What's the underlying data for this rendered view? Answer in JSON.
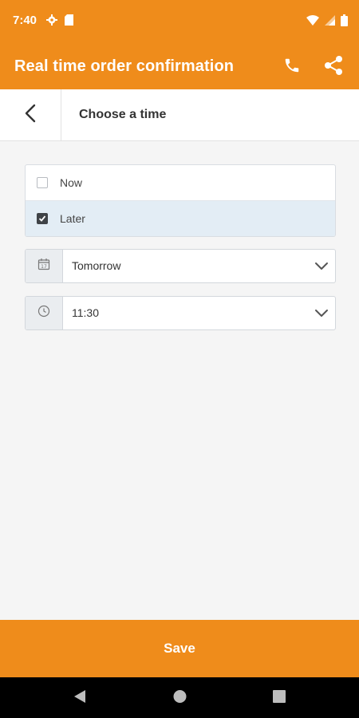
{
  "status_bar": {
    "time": "7:40",
    "icons": [
      "settings-icon",
      "sim-card-icon",
      "wifi-icon",
      "signal-icon",
      "battery-icon"
    ],
    "text_color": "#ffffff"
  },
  "app_bar": {
    "title": "Real time order confirmation",
    "actions": [
      "phone-icon",
      "share-icon"
    ],
    "color": "#ef8c1b"
  },
  "sub_header": {
    "back_icon": "chevron-left-icon",
    "title": "Choose a time"
  },
  "options": [
    {
      "label": "Now",
      "checked": false
    },
    {
      "label": "Later",
      "checked": true
    }
  ],
  "date_select": {
    "icon": "calendar-icon",
    "value": "Tomorrow"
  },
  "time_select": {
    "icon": "clock-icon",
    "value": "11:30"
  },
  "save": {
    "label": "Save"
  },
  "nav_bar": {
    "buttons": [
      "back-triangle-icon",
      "home-circle-icon",
      "recents-square-icon"
    ]
  }
}
